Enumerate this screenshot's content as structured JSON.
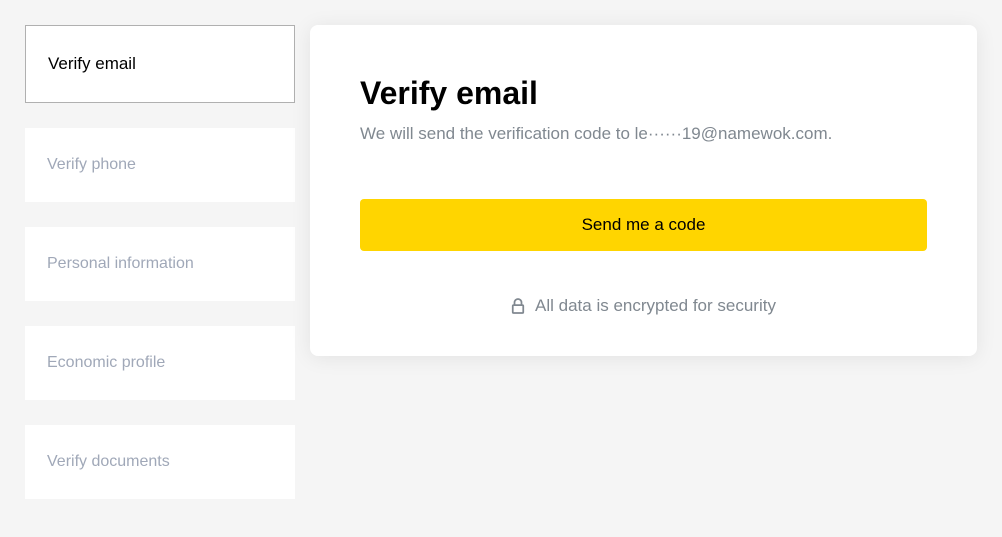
{
  "sidebar": {
    "items": [
      {
        "label": "Verify email",
        "active": true
      },
      {
        "label": "Verify phone",
        "active": false
      },
      {
        "label": "Personal information",
        "active": false
      },
      {
        "label": "Economic profile",
        "active": false
      },
      {
        "label": "Verify documents",
        "active": false
      }
    ]
  },
  "main": {
    "title": "Verify email",
    "subtitle": "We will send the verification code to le······19@namewok.com.",
    "button_label": "Send me a code",
    "security_text": "All data is encrypted for security"
  }
}
